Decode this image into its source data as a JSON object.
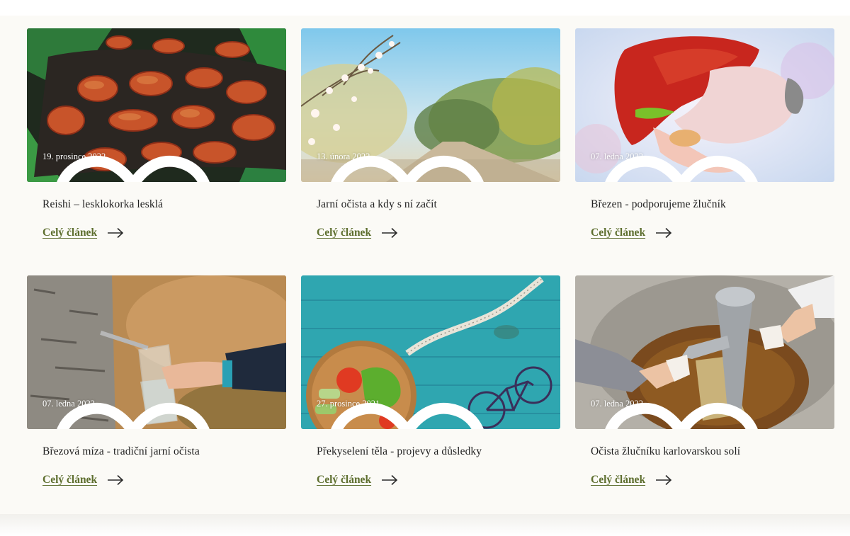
{
  "articles": [
    {
      "date": "19. prosince 2022",
      "title": "Reishi – lesklokorka lesklá",
      "link_label": "Celý článek",
      "image": "reishi-mushrooms"
    },
    {
      "date": "13. února 2022",
      "title": "Jarní očista a kdy s ní začít",
      "link_label": "Celý článek",
      "image": "spring-blossom-path"
    },
    {
      "date": "07. ledna 2022",
      "title": "Březen - podporujeme žlučník",
      "link_label": "Celý článek",
      "image": "liver-gallbladder-illustration"
    },
    {
      "date": "07. ledna 2022",
      "title": "Březová míza - tradiční jarní očista",
      "link_label": "Celý článek",
      "image": "birch-sap-glass"
    },
    {
      "date": "27. prosince 2021",
      "title": "Překyselení těla - projevy a důsledky",
      "link_label": "Celý článek",
      "image": "vegetables-bicycle-tape"
    },
    {
      "date": "07. ledna 2022",
      "title": "Očista žlučníku karlovarskou solí",
      "link_label": "Celý článek",
      "image": "karlovy-vary-spring"
    }
  ],
  "colors": {
    "accent": "#5e6f2f",
    "background": "#fbfaf6",
    "text": "#1f1f1f"
  },
  "icons": {
    "favorite": "heart-outline-icon",
    "more": "arrow-right-icon"
  }
}
